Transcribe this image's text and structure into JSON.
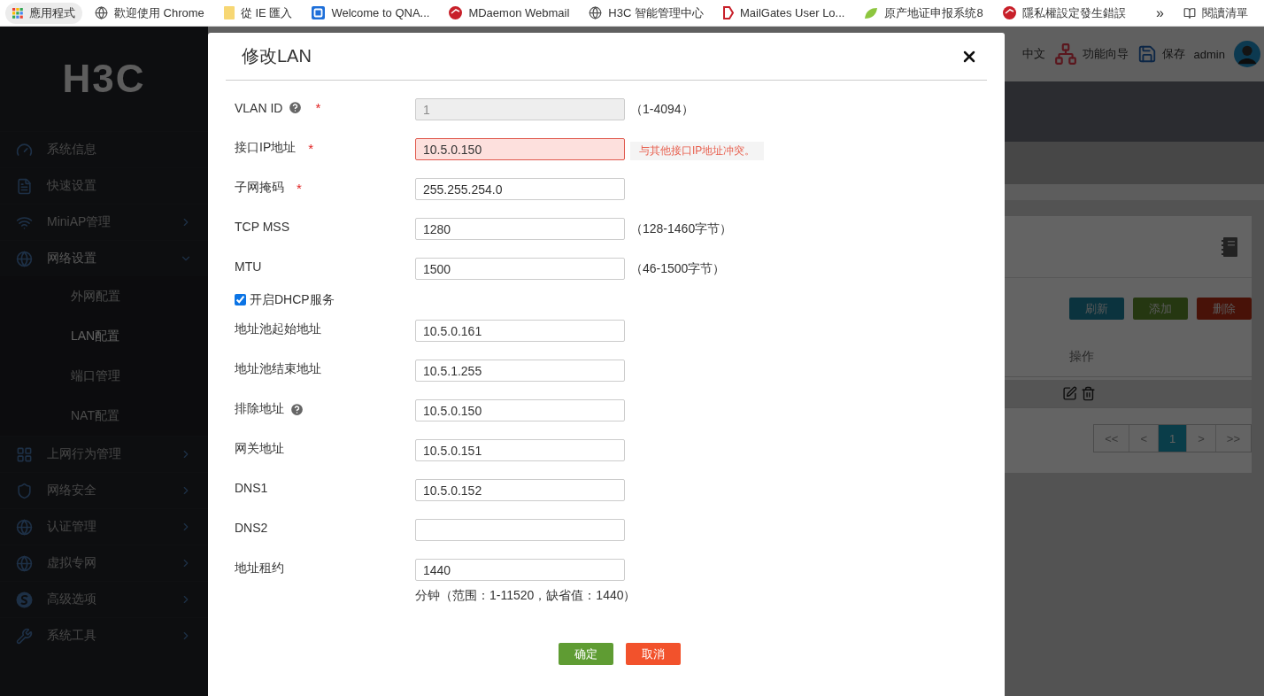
{
  "bookmarks_bar": {
    "items": [
      {
        "label": "應用程式",
        "kind": "apps"
      },
      {
        "label": "歡迎使用 Chrome",
        "kind": "globe"
      },
      {
        "label": "從 IE 匯入",
        "kind": "folder"
      },
      {
        "label": "Welcome to QNA...",
        "kind": "qbox"
      },
      {
        "label": "MDaemon Webmail",
        "kind": "roundlogo"
      },
      {
        "label": "H3C 智能管理中心",
        "kind": "globe"
      },
      {
        "label": "MailGates User Lo...",
        "kind": "bracket"
      },
      {
        "label": "原产地证申报系统8",
        "kind": "leaf"
      },
      {
        "label": "隱私權設定發生錯誤",
        "kind": "roundlogo"
      }
    ],
    "overflow": "»",
    "reading_list": "閱讀清單"
  },
  "sidebar": {
    "logo": "H3C",
    "items": [
      {
        "label": "系统信息",
        "expandable": false,
        "expanded": false
      },
      {
        "label": "快速设置",
        "expandable": false,
        "expanded": false
      },
      {
        "label": "MiniAP管理",
        "expandable": true,
        "expanded": false
      },
      {
        "label": "网络设置",
        "expandable": true,
        "expanded": true,
        "children": [
          {
            "label": "外网配置",
            "selected": false
          },
          {
            "label": "LAN配置",
            "selected": true
          },
          {
            "label": "端口管理",
            "selected": false
          },
          {
            "label": "NAT配置",
            "selected": false
          }
        ]
      },
      {
        "label": "上网行为管理",
        "expandable": true,
        "expanded": false
      },
      {
        "label": "网络安全",
        "expandable": true,
        "expanded": false
      },
      {
        "label": "认证管理",
        "expandable": true,
        "expanded": false
      },
      {
        "label": "虚拟专网",
        "expandable": true,
        "expanded": false
      },
      {
        "label": "高级选项",
        "expandable": true,
        "expanded": false
      },
      {
        "label": "系统工具",
        "expandable": true,
        "expanded": false
      }
    ]
  },
  "header": {
    "language": "中文",
    "wizard": "功能向导",
    "save": "保存",
    "user": "admin"
  },
  "card": {
    "buttons": [
      "刷新",
      "添加",
      "删除"
    ],
    "table_columns": [
      "操作"
    ],
    "pagination": [
      {
        "label": "<<",
        "selected": false
      },
      {
        "label": "<",
        "selected": false
      },
      {
        "label": "1",
        "selected": true
      },
      {
        "label": ">",
        "selected": false
      },
      {
        "label": ">>",
        "selected": false
      }
    ]
  },
  "dialog": {
    "title": "修改LAN",
    "fields": [
      {
        "label": "VLAN ID",
        "help": true,
        "required_mark": "*",
        "value": "1",
        "disabled": true,
        "invalid": false,
        "hint": "（1-4094）"
      },
      {
        "label": "接口IP地址",
        "help": false,
        "required_mark": "*",
        "value": "10.5.0.150",
        "disabled": false,
        "invalid": true,
        "error": "与其他接口IP地址冲突。"
      },
      {
        "label": "子网掩码",
        "help": false,
        "required_mark": "*",
        "value": "255.255.254.0",
        "disabled": false,
        "invalid": false
      },
      {
        "label": "TCP MSS",
        "help": false,
        "value": "1280",
        "disabled": false,
        "invalid": false,
        "hint": "（128-1460字节）"
      },
      {
        "label": "MTU",
        "help": false,
        "value": "1500",
        "disabled": false,
        "invalid": false,
        "hint": "（46-1500字节）"
      }
    ],
    "dhcp": {
      "label": "开启DHCP服务",
      "checked": true
    },
    "dhcp_fields": [
      {
        "label": "地址池起始地址",
        "help": false,
        "value": "10.5.0.161",
        "disabled": false,
        "invalid": false
      },
      {
        "label": "地址池结束地址",
        "help": false,
        "value": "10.5.1.255",
        "disabled": false,
        "invalid": false
      },
      {
        "label": "排除地址",
        "help": true,
        "value": "10.5.0.150",
        "disabled": false,
        "invalid": false
      },
      {
        "label": "网关地址",
        "help": false,
        "value": "10.5.0.151",
        "disabled": false,
        "invalid": false
      },
      {
        "label": "DNS1",
        "help": false,
        "value": "10.5.0.152",
        "disabled": false,
        "invalid": false
      },
      {
        "label": "DNS2",
        "help": false,
        "disabled": false,
        "invalid": false
      },
      {
        "label": "地址租约",
        "help": false,
        "value": "1440",
        "disabled": false,
        "invalid": false
      }
    ],
    "note": "分钟（范围：1-11520，缺省值：1440）",
    "buttons": [
      {
        "label": "确定",
        "kind": "ok"
      },
      {
        "label": "取消",
        "kind": "cancel"
      }
    ]
  }
}
